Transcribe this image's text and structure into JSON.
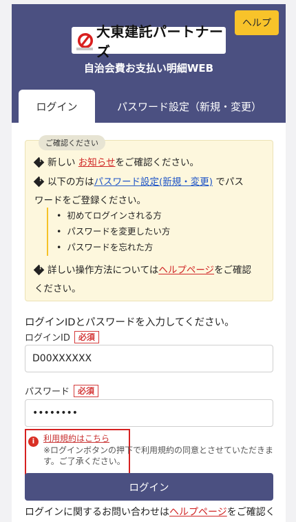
{
  "header": {
    "help_label": "ヘルプ",
    "logo_text": "大東建託パートナーズ",
    "app_title": "自治会費お支払い明細WEB"
  },
  "tabs": [
    {
      "label": "ログイン",
      "active": true
    },
    {
      "label": "パスワード設定（新規・変更）",
      "active": false
    }
  ],
  "notice": {
    "badge": "ご確認ください",
    "line1": {
      "pre": "新しい",
      "link": "お知らせ",
      "post": "をご確認ください。"
    },
    "line2": {
      "pre": "以下の方は",
      "link": "パスワード設定(新規・変更)",
      "post": "でパス"
    },
    "line2b": "ワードをご登録ください。",
    "bullets": [
      "初めてログインされる方",
      "パスワードを変更したい方",
      "パスワードを忘れた方"
    ],
    "line3": {
      "pre": "詳しい操作方法については",
      "link": "ヘルプページ",
      "post": "をご確認"
    },
    "line3b": "ください。"
  },
  "form": {
    "instruction": "ログインIDとパスワードを入力してください。",
    "login_id_label": "ログインID",
    "password_label": "パスワード",
    "required_label": "必須",
    "login_id_value": "D00XXXXXX",
    "password_value": "••••••••",
    "terms_link": "利用規約はこちら",
    "terms_note": "※ログインボタンの押下で利用規約の同意とさせていただきます。ご了承ください。",
    "login_button": "ログイン",
    "inquiry": {
      "pre": "ログインに関するお問い合わせは",
      "link": "ヘルプページ",
      "post": "をご確認く"
    }
  },
  "colors": {
    "header_bg": "#4b5081",
    "help_button": "#f8c32a",
    "notice_bg": "#fdf7dd",
    "link_red": "#d02525",
    "link_blue": "#1f55c7",
    "highlight_border": "#d62020"
  }
}
